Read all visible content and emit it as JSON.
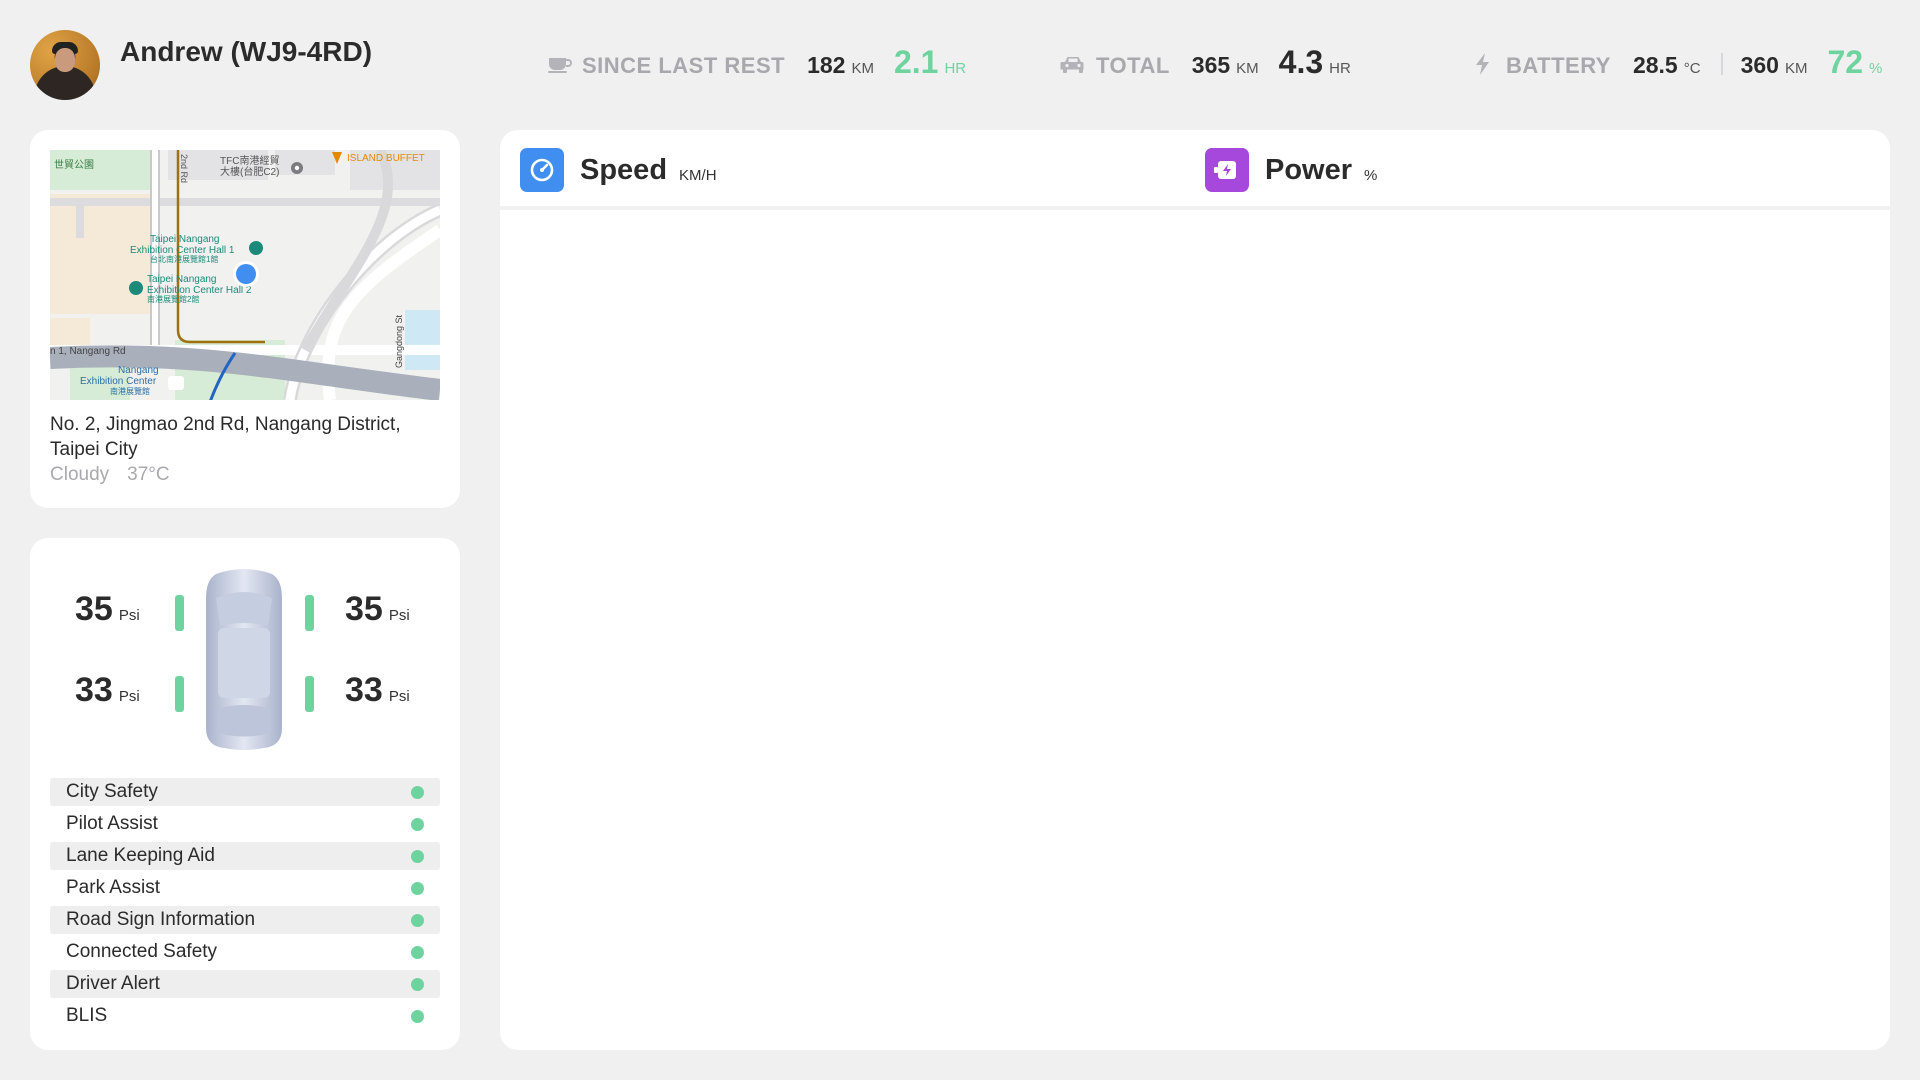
{
  "driver": {
    "name": "Andrew (WJ9-4RD)"
  },
  "stats": {
    "since_last_rest": {
      "label": "SINCE LAST REST",
      "distance": "182",
      "distance_unit": "KM",
      "time": "2.1",
      "time_unit": "HR",
      "icon": "coffee-cup-icon"
    },
    "total": {
      "label": "TOTAL",
      "distance": "365",
      "distance_unit": "KM",
      "time": "4.3",
      "time_unit": "HR",
      "icon": "car-icon"
    },
    "battery": {
      "label": "BATTERY",
      "temperature": "28.5",
      "temperature_unit": "°C",
      "range": "360",
      "range_unit": "KM",
      "level": "72",
      "level_unit": "%",
      "icon": "lightning-bolt-icon"
    }
  },
  "location": {
    "map_labels": {
      "park": "世貿公園",
      "tfc": "TFC南港經貿",
      "tfc2": "大樓(台肥C2)",
      "buffet": "ISLAND BUFFET",
      "road_2nd": "2nd Rd",
      "hall1_a": "Taipei Nangang",
      "hall1_b": "Exhibition Center Hall 1",
      "hall1_c": "台北南港展覽館1館",
      "hall2_a": "Taipei Nangang",
      "hall2_b": "Exhibition Center Hall 2",
      "hall2_c": "南港展覽館2館",
      "nangang_rd": "n 1, Nangang Rd",
      "station_a": "Nangang",
      "station_b": "Exhibition Center",
      "station_c": "南港展覽館",
      "gangdong": "Gangdong St"
    },
    "address": "No. 2, Jingmao 2nd Rd, Nangang District, Taipei City",
    "weather": "Cloudy",
    "temperature": "37°C"
  },
  "tires": {
    "front_left": "35",
    "front_right": "35",
    "rear_left": "33",
    "rear_right": "33",
    "unit": "Psi",
    "status_color": "#6fd39f"
  },
  "features": [
    {
      "label": "City Safety",
      "status": "active"
    },
    {
      "label": "Pilot Assist",
      "status": "active"
    },
    {
      "label": "Lane Keeping Aid",
      "status": "active"
    },
    {
      "label": "Park Assist",
      "status": "active"
    },
    {
      "label": "Road Sign Information",
      "status": "active"
    },
    {
      "label": "Connected Safety",
      "status": "active"
    },
    {
      "label": "Driver Alert",
      "status": "active"
    },
    {
      "label": "BLIS",
      "status": "active"
    }
  ],
  "charts": {
    "speed": {
      "title": "Speed",
      "unit": "KM/H",
      "icon": "speedometer-icon",
      "color": "#3f8ef0"
    },
    "power": {
      "title": "Power",
      "unit": "%",
      "icon": "battery-charge-icon",
      "color": "#a648dc"
    }
  },
  "colors": {
    "accent_green": "#6fd39f",
    "background": "#f0f0f1"
  }
}
